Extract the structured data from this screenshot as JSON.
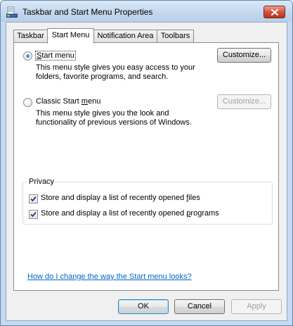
{
  "window": {
    "title": "Taskbar and Start Menu Properties",
    "icons": {
      "app": "taskbar-properties-icon",
      "close": "close-icon"
    }
  },
  "tabs": [
    {
      "label": "Taskbar",
      "active": false
    },
    {
      "label": "Start Menu",
      "active": true
    },
    {
      "label": "Notification Area",
      "active": false
    },
    {
      "label": "Toolbars",
      "active": false
    }
  ],
  "start_menu_option": {
    "label_mnemonic": "S",
    "label_rest": "tart menu",
    "selected": true,
    "description": "This menu style gives you easy access to your\nfolders, favorite programs, and search.",
    "customize_label": "Customize...",
    "customize_enabled": true
  },
  "classic_option": {
    "label_prefix": "Classic Start ",
    "label_mnemonic": "m",
    "label_rest": "enu",
    "selected": false,
    "description": "This menu style gives you the look and\nfunctionality of previous versions of Windows.",
    "customize_label": "Customize...",
    "customize_enabled": false
  },
  "privacy": {
    "legend": "Privacy",
    "files_prefix": "Store and display a list of recently opened ",
    "files_mnemonic": "f",
    "files_rest": "iles",
    "files_checked": true,
    "programs_prefix": "Store and display a list of recently opened ",
    "programs_mnemonic": "p",
    "programs_rest": "rograms",
    "programs_checked": true
  },
  "help_link": "How do I change the way the Start menu looks?",
  "buttons": {
    "ok": "OK",
    "cancel_mnemonic": "",
    "cancel": "Cancel",
    "apply": "Apply",
    "apply_enabled": false
  },
  "colors": {
    "accent": "#1d5da4",
    "link": "#0066cc",
    "close": "#c8442b"
  }
}
